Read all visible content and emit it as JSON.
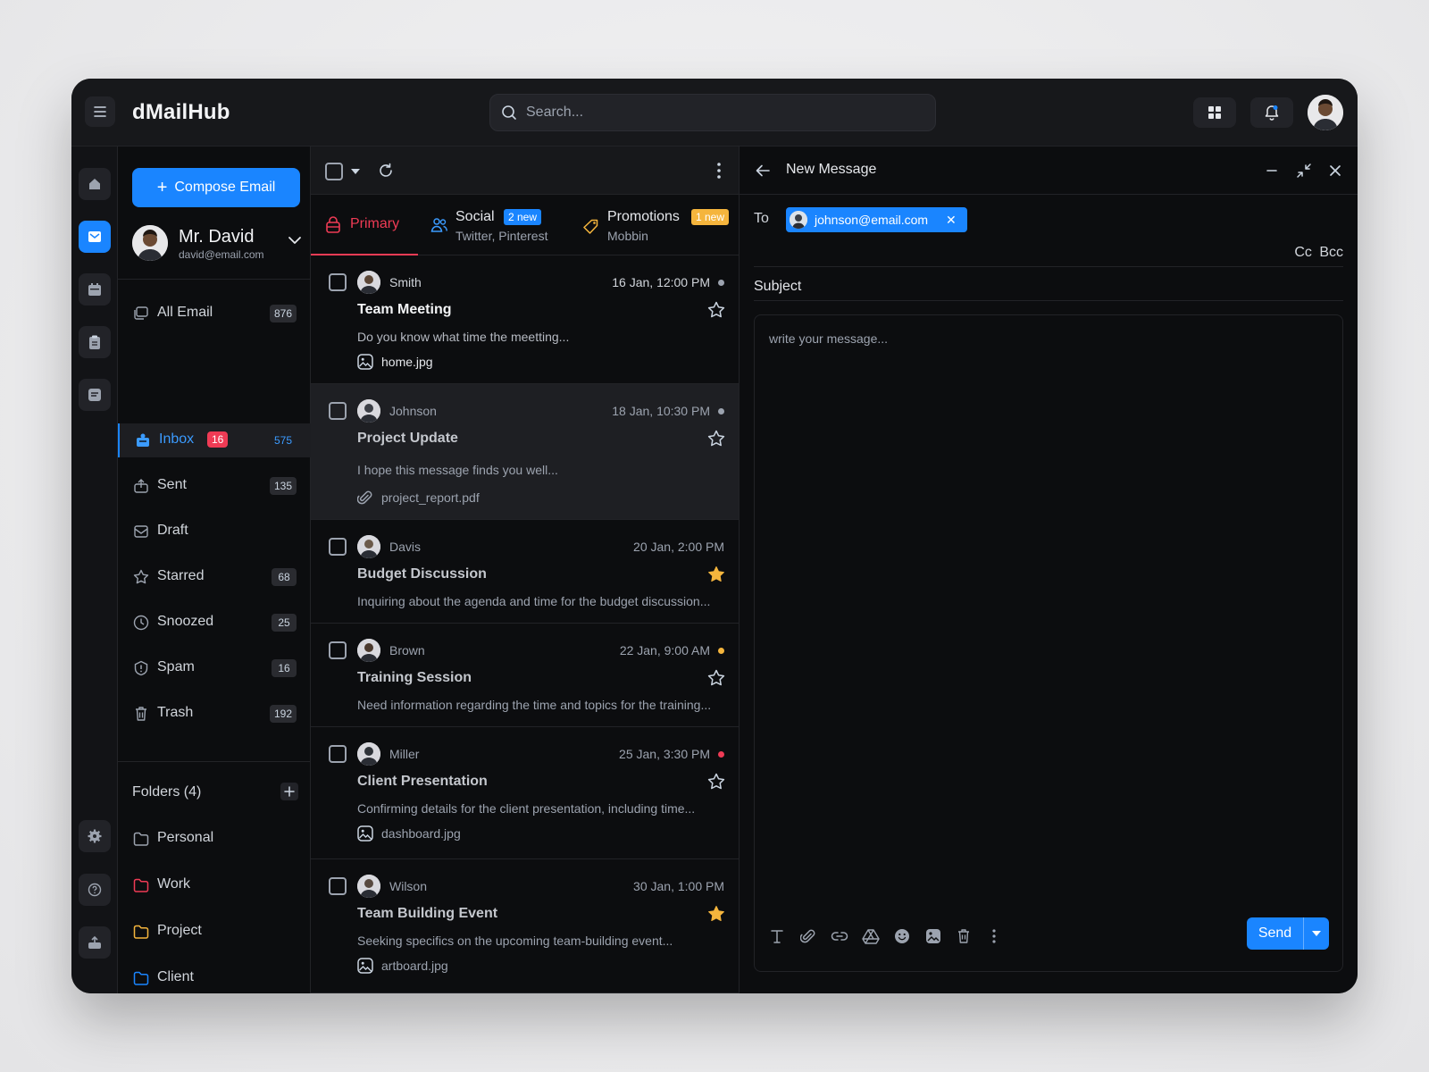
{
  "app": {
    "title": "dMailHub",
    "search_placeholder": "Search..."
  },
  "user": {
    "name": "Mr. David",
    "email": "david@email.com"
  },
  "sidebar": {
    "compose_label": "Compose Email",
    "items": [
      {
        "label": "All Email",
        "count": "876"
      },
      {
        "label": "Inbox",
        "badge": "16",
        "count": "575"
      },
      {
        "label": "Sent",
        "count": "135"
      },
      {
        "label": "Draft",
        "count": ""
      },
      {
        "label": "Starred",
        "count": "68"
      },
      {
        "label": "Snoozed",
        "count": "25"
      },
      {
        "label": "Spam",
        "count": "16"
      },
      {
        "label": "Trash",
        "count": "192"
      }
    ],
    "folders_title": "Folders (4)",
    "folders": [
      {
        "label": "Personal",
        "color": "#9ca3af"
      },
      {
        "label": "Work",
        "color": "#ef3b55"
      },
      {
        "label": "Project",
        "color": "#f5b53d"
      },
      {
        "label": "Client",
        "color": "#1a85ff"
      }
    ]
  },
  "tabs": {
    "primary": {
      "label": "Primary"
    },
    "social": {
      "label": "Social",
      "badge": "2 new",
      "sub": "Twitter, Pinterest"
    },
    "promotions": {
      "label": "Promotions",
      "badge": "1 new",
      "sub": "Mobbin"
    }
  },
  "emails": [
    {
      "sender": "Smith",
      "date": "16 Jan, 12:00 PM",
      "subject": "Team Meeting",
      "preview": "Do you know what time the meetting...",
      "attachment": "home.jpg",
      "attachment_type": "image",
      "dot": "#9ca3af",
      "starred": false
    },
    {
      "sender": "Johnson",
      "date": "18 Jan, 10:30 PM",
      "subject": "Project Update",
      "preview": "I hope this message finds you well...",
      "attachment": "project_report.pdf",
      "attachment_type": "link",
      "dot": "#9ca3af",
      "starred": false
    },
    {
      "sender": "Davis",
      "date": "20 Jan, 2:00 PM",
      "subject": "Budget Discussion",
      "preview": "Inquiring about the agenda and time for the budget discussion...",
      "attachment": "",
      "dot": "",
      "starred": true
    },
    {
      "sender": "Brown",
      "date": "22 Jan, 9:00 AM",
      "subject": "Training Session",
      "preview": "Need information regarding the time and topics for the training...",
      "attachment": "",
      "dot": "#f5b53d",
      "starred": false
    },
    {
      "sender": "Miller",
      "date": "25 Jan, 3:30 PM",
      "subject": "Client Presentation",
      "preview": "Confirming details for the client presentation, including time...",
      "attachment": "dashboard.jpg",
      "attachment_type": "image",
      "dot": "#ef3b55",
      "starred": false
    },
    {
      "sender": "Wilson",
      "date": "30 Jan, 1:00 PM",
      "subject": "Team Building Event",
      "preview": "Seeking specifics on the upcoming team-building event...",
      "attachment": "artboard.jpg",
      "attachment_type": "image",
      "dot": "",
      "starred": true
    }
  ],
  "compose": {
    "title": "New Message",
    "to_label": "To",
    "recipient": "johnson@email.com",
    "cc_bcc": "Cc Bcc",
    "subject_label": "Subject",
    "message_placeholder": "write your message...",
    "send_label": "Send"
  },
  "colors": {
    "accent": "#1a85ff",
    "danger": "#ef3b55",
    "warning": "#f5b53d",
    "bg": "#0c0d0f"
  }
}
